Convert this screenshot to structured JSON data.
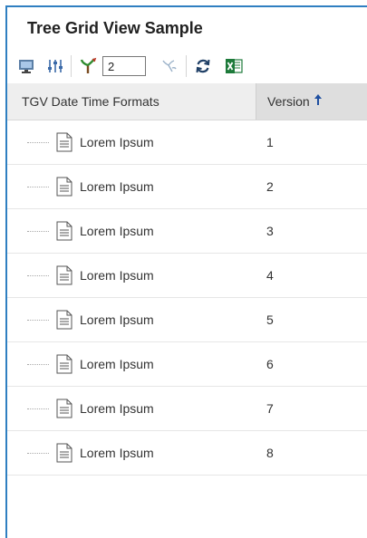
{
  "window": {
    "title": "Tree Grid View Sample"
  },
  "toolbar": {
    "items": [
      {
        "name": "monitor-icon"
      },
      {
        "name": "column-settings-icon"
      },
      {
        "name": "expand-tree-icon"
      },
      {
        "name": "collapse-tree-icon"
      },
      {
        "name": "refresh-icon"
      },
      {
        "name": "excel-export-icon"
      }
    ],
    "depth_value": "2"
  },
  "grid": {
    "columns": {
      "name": "TGV Date Time Formats",
      "version": "Version"
    },
    "sort": {
      "column": "version",
      "direction": "ascending"
    },
    "rows": [
      {
        "label": "Lorem Ipsum",
        "version": "1"
      },
      {
        "label": "Lorem Ipsum",
        "version": "2"
      },
      {
        "label": "Lorem Ipsum",
        "version": "3"
      },
      {
        "label": "Lorem Ipsum",
        "version": "4"
      },
      {
        "label": "Lorem Ipsum",
        "version": "5"
      },
      {
        "label": "Lorem Ipsum",
        "version": "6"
      },
      {
        "label": "Lorem Ipsum",
        "version": "7"
      },
      {
        "label": "Lorem Ipsum",
        "version": "8"
      }
    ]
  },
  "colors": {
    "accent_border": "#2f7fc1",
    "sort_arrow": "#1f4fa0",
    "excel_green": "#1d7a3a"
  }
}
